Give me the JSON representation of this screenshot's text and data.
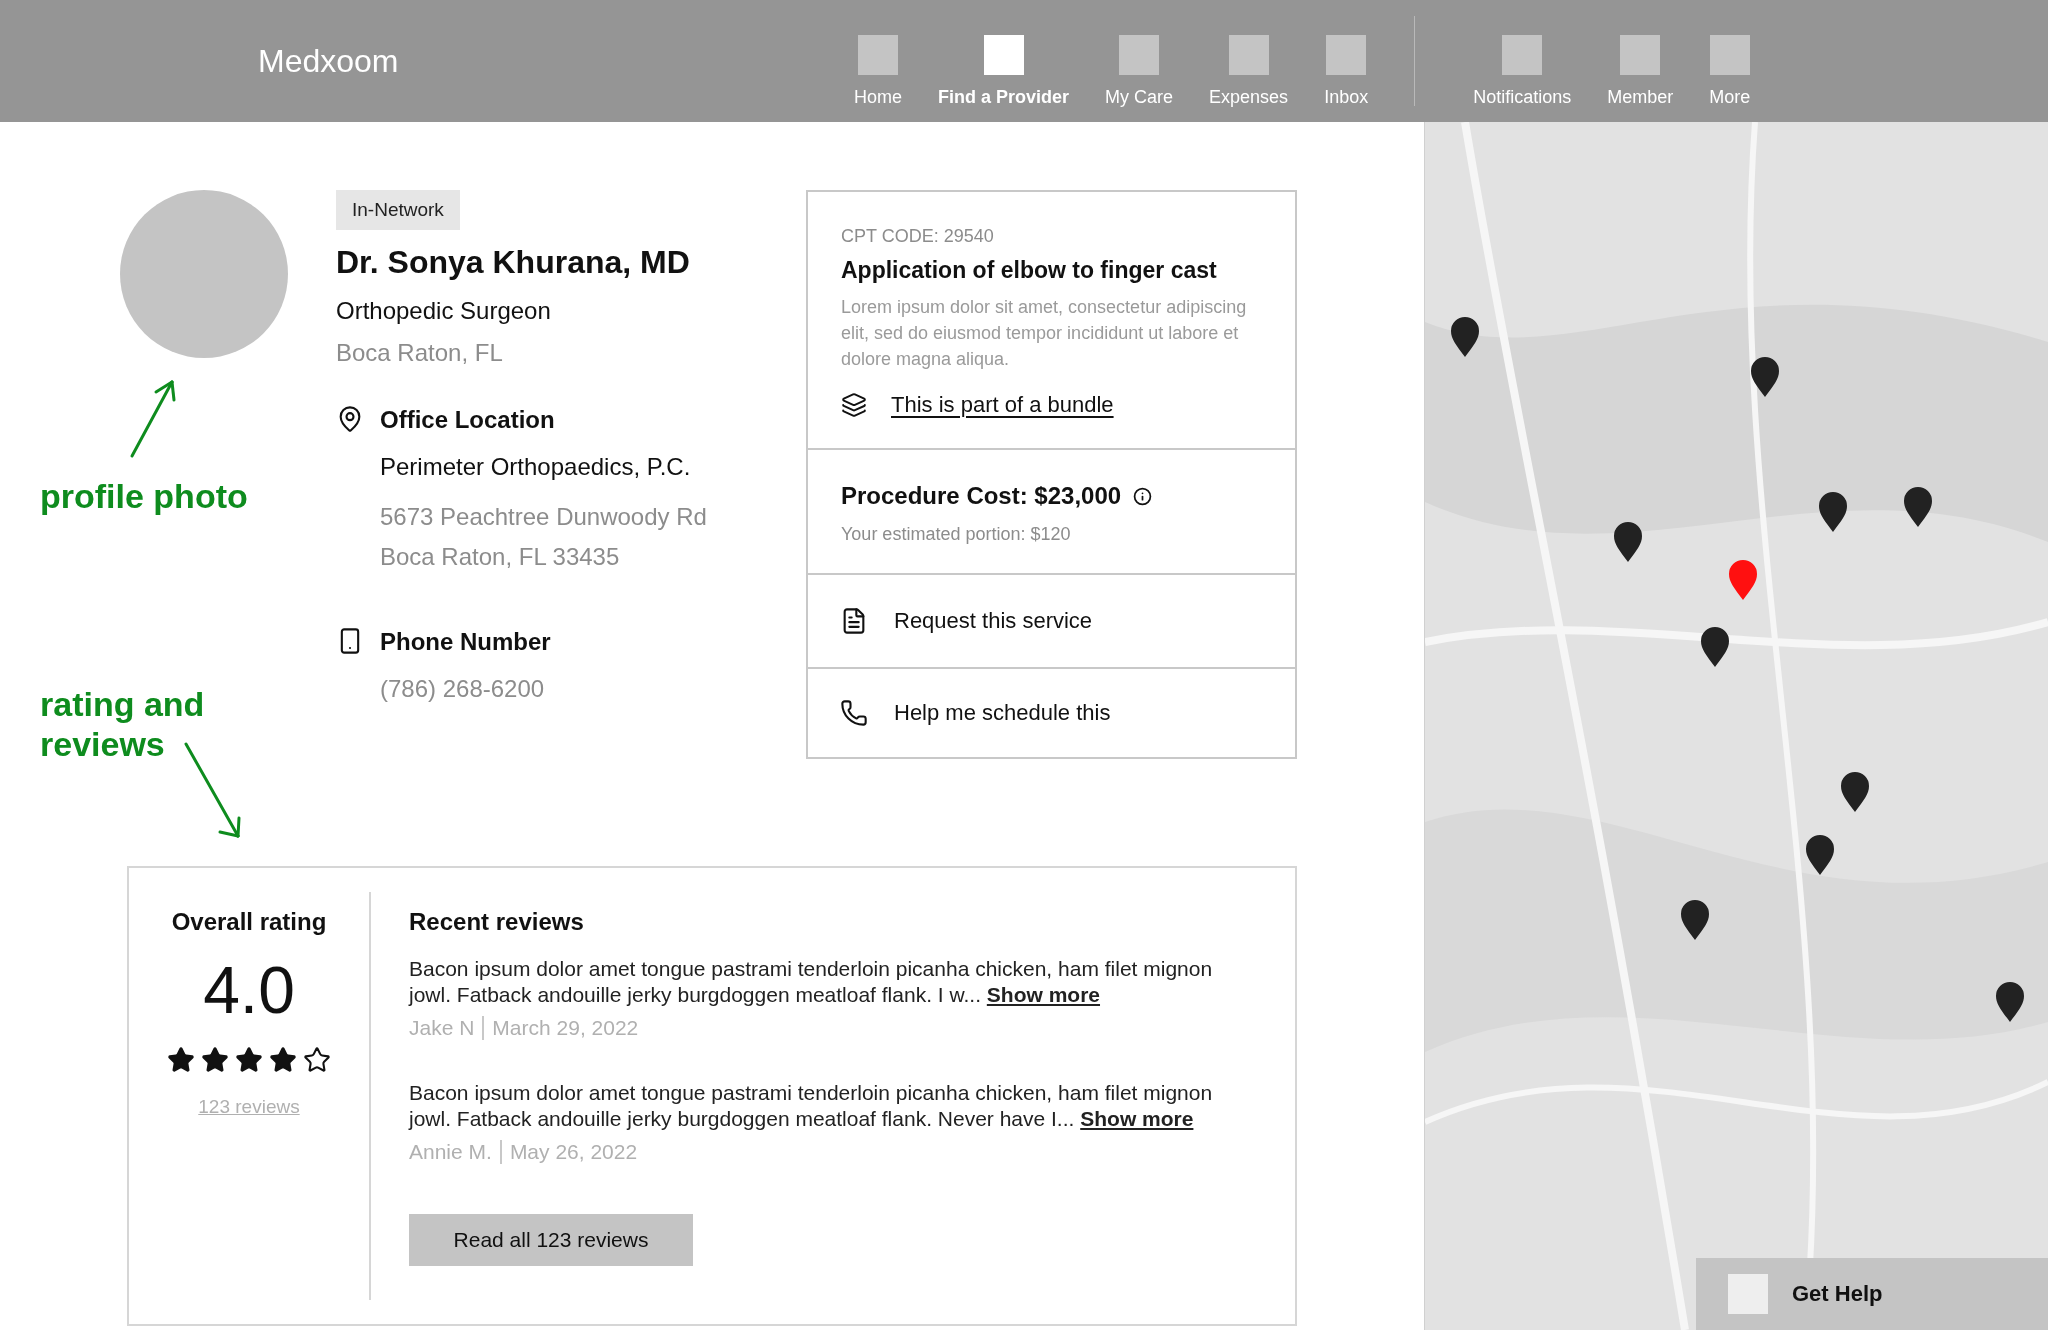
{
  "header": {
    "logo": "Medxoom",
    "nav_primary": [
      {
        "label": "Home",
        "selected": false
      },
      {
        "label": "Find a Provider",
        "selected": true
      },
      {
        "label": "My Care",
        "selected": false
      },
      {
        "label": "Expenses",
        "selected": false
      },
      {
        "label": "Inbox",
        "selected": false
      }
    ],
    "nav_secondary": [
      {
        "label": "Notifications",
        "selected": false
      },
      {
        "label": "Member",
        "selected": false
      },
      {
        "label": "More",
        "selected": false
      }
    ]
  },
  "annotations": {
    "photo_note": "profile photo",
    "rating_note": "rating and reviews"
  },
  "provider": {
    "badge": "In-Network",
    "name": "Dr. Sonya Khurana, MD",
    "specialty": "Orthopedic Surgeon",
    "city": "Boca Raton, FL",
    "office": {
      "heading": "Office Location",
      "practice": "Perimeter Orthopaedics, P.C.",
      "address_lines": [
        "5673 Peachtree Dunwoody Rd",
        "Boca Raton, FL 33435"
      ]
    },
    "phone": {
      "heading": "Phone Number",
      "number": "(786) 268-6200"
    }
  },
  "service_card": {
    "code": "CPT CODE: 29540",
    "title": "Application of elbow to finger cast",
    "description": "Lorem ipsum dolor sit amet, consectetur adipiscing elit, sed do eiusmod tempor incididunt ut labore et dolore magna aliqua.",
    "bundle_link": "This is part of a bundle",
    "cost": "Procedure Cost: $23,000",
    "portion": "Your estimated portion: $120",
    "actions": [
      {
        "kind": "document",
        "label": "Request this service"
      },
      {
        "kind": "phone",
        "label": "Help me schedule this"
      }
    ]
  },
  "ratings": {
    "heading": "Overall rating",
    "score": "4.0",
    "stars": 4,
    "count_link": "123 reviews",
    "reviews_heading": "Recent reviews",
    "reviews": [
      {
        "text": "Bacon ipsum dolor amet tongue pastrami tenderloin picanha chicken, ham filet mignon jowl. Fatback andouille jerky burgdoggen meatloaf flank. I w...",
        "more": "Show more",
        "author": "Jake N",
        "date": "March 29, 2022"
      },
      {
        "text": "Bacon ipsum dolor amet tongue pastrami tenderloin picanha chicken, ham filet mignon jowl. Fatback andouille jerky burgdoggen meatloaf flank. Never have I...",
        "more": "Show more",
        "author": "Annie M.",
        "date": "May 26, 2022"
      }
    ],
    "read_all": "Read all 123 reviews"
  },
  "help": {
    "label": "Get Help"
  }
}
